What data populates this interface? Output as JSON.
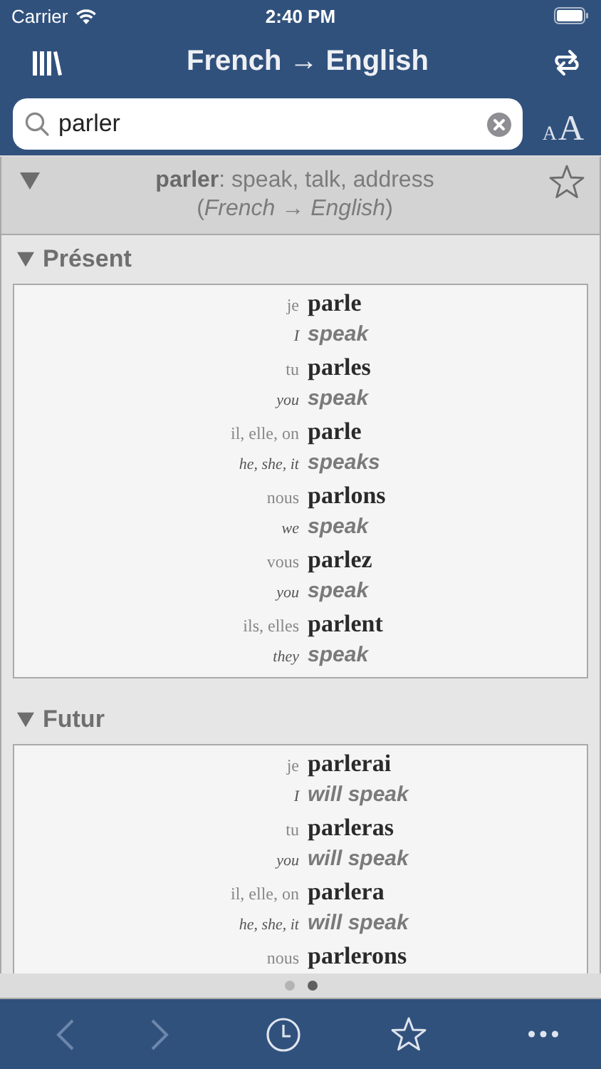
{
  "status_bar": {
    "carrier": "Carrier",
    "time": "2:40 PM"
  },
  "nav_bar": {
    "title": "French → English"
  },
  "search": {
    "value": "parler"
  },
  "font_size_button": {
    "small": "A",
    "large": "A"
  },
  "entry": {
    "expanded": true,
    "headword": "parler",
    "definition": ": speak, talk, address",
    "language": "(*French* → *English*)",
    "favorite": false
  },
  "sections": [
    {
      "title": "Présent",
      "expanded": true,
      "rows": [
        {
          "pronoun": "je",
          "verb": "parle",
          "pronoun_en": "I",
          "verb_en": "speak"
        },
        {
          "pronoun": "tu",
          "verb": "parles",
          "pronoun_en": "you",
          "verb_en": "speak"
        },
        {
          "pronoun": "il, elle, on",
          "verb": "parle",
          "pronoun_en": "he, she, it",
          "verb_en": "speaks"
        },
        {
          "pronoun": "nous",
          "verb": "parlons",
          "pronoun_en": "we",
          "verb_en": "speak"
        },
        {
          "pronoun": "vous",
          "verb": "parlez",
          "pronoun_en": "you",
          "verb_en": "speak"
        },
        {
          "pronoun": "ils, elles",
          "verb": "parlent",
          "pronoun_en": "they",
          "verb_en": "speak"
        }
      ]
    },
    {
      "title": "Futur",
      "expanded": true,
      "rows": [
        {
          "pronoun": "je",
          "verb": "parlerai",
          "pronoun_en": "I",
          "verb_en": "will speak"
        },
        {
          "pronoun": "tu",
          "verb": "parleras",
          "pronoun_en": "you",
          "verb_en": "will speak"
        },
        {
          "pronoun": "il, elle, on",
          "verb": "parlera",
          "pronoun_en": "he, she, it",
          "verb_en": "will speak"
        },
        {
          "pronoun": "nous",
          "verb": "parlerons"
        }
      ]
    }
  ],
  "page_dots": [
    {
      "selected": false
    },
    {
      "selected": true
    }
  ],
  "toolbar": {
    "back_disabled": true,
    "forward_disabled": true
  }
}
